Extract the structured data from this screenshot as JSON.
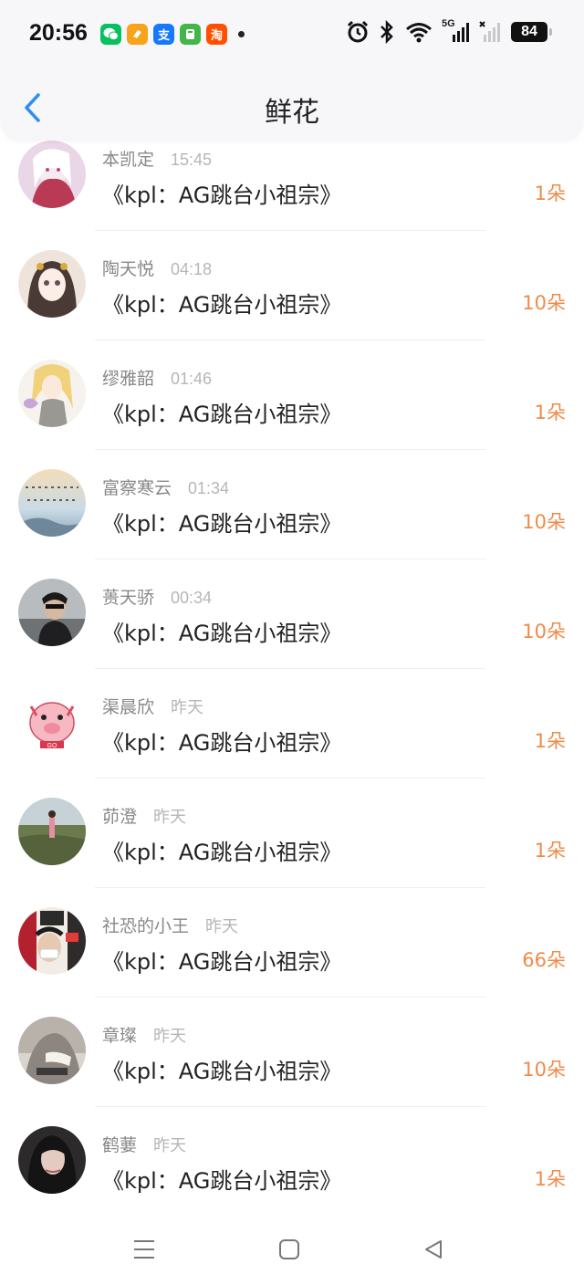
{
  "status_bar": {
    "time": "20:56",
    "apps": [
      {
        "icon": "wechat-icon",
        "glyph": "",
        "color": "#07c160"
      },
      {
        "icon": "app-orange-icon",
        "glyph": "",
        "color": "#f7a31c"
      },
      {
        "icon": "alipay-icon",
        "glyph": "支",
        "color": "#1677ff"
      },
      {
        "icon": "app-green-icon",
        "glyph": "",
        "color": "#43b649"
      },
      {
        "icon": "taobao-icon",
        "glyph": "淘",
        "color": "#ff5000"
      }
    ],
    "network": "5G",
    "battery": "84"
  },
  "header": {
    "title": "鲜花"
  },
  "items": [
    {
      "name": "本凯定",
      "time": "15:45",
      "book": "《kpl：AG跳台小祖宗》",
      "count": "1朵",
      "avatar": "a1"
    },
    {
      "name": "陶天悦",
      "time": "04:18",
      "book": "《kpl：AG跳台小祖宗》",
      "count": "10朵",
      "avatar": "a2"
    },
    {
      "name": "缪雅韶",
      "time": "01:46",
      "book": "《kpl：AG跳台小祖宗》",
      "count": "1朵",
      "avatar": "a3"
    },
    {
      "name": "富察寒云",
      "time": "01:34",
      "book": "《kpl：AG跳台小祖宗》",
      "count": "10朵",
      "avatar": "a4"
    },
    {
      "name": "蒉天骄",
      "time": "00:34",
      "book": "《kpl：AG跳台小祖宗》",
      "count": "10朵",
      "avatar": "a5"
    },
    {
      "name": "渠晨欣",
      "time": "昨天",
      "book": "《kpl：AG跳台小祖宗》",
      "count": "1朵",
      "avatar": "a6"
    },
    {
      "name": "茆澄",
      "time": "昨天",
      "book": "《kpl：AG跳台小祖宗》",
      "count": "1朵",
      "avatar": "a7"
    },
    {
      "name": "社恐的小王",
      "time": "昨天",
      "book": "《kpl：AG跳台小祖宗》",
      "count": "66朵",
      "avatar": "a8"
    },
    {
      "name": "章璨",
      "time": "昨天",
      "book": "《kpl：AG跳台小祖宗》",
      "count": "10朵",
      "avatar": "a9"
    },
    {
      "name": "鹤葽",
      "time": "昨天",
      "book": "《kpl：AG跳台小祖宗》",
      "count": "1朵",
      "avatar": "a10"
    }
  ],
  "colors": {
    "accent": "#ef8b4a",
    "back": "#2f8ff0"
  }
}
